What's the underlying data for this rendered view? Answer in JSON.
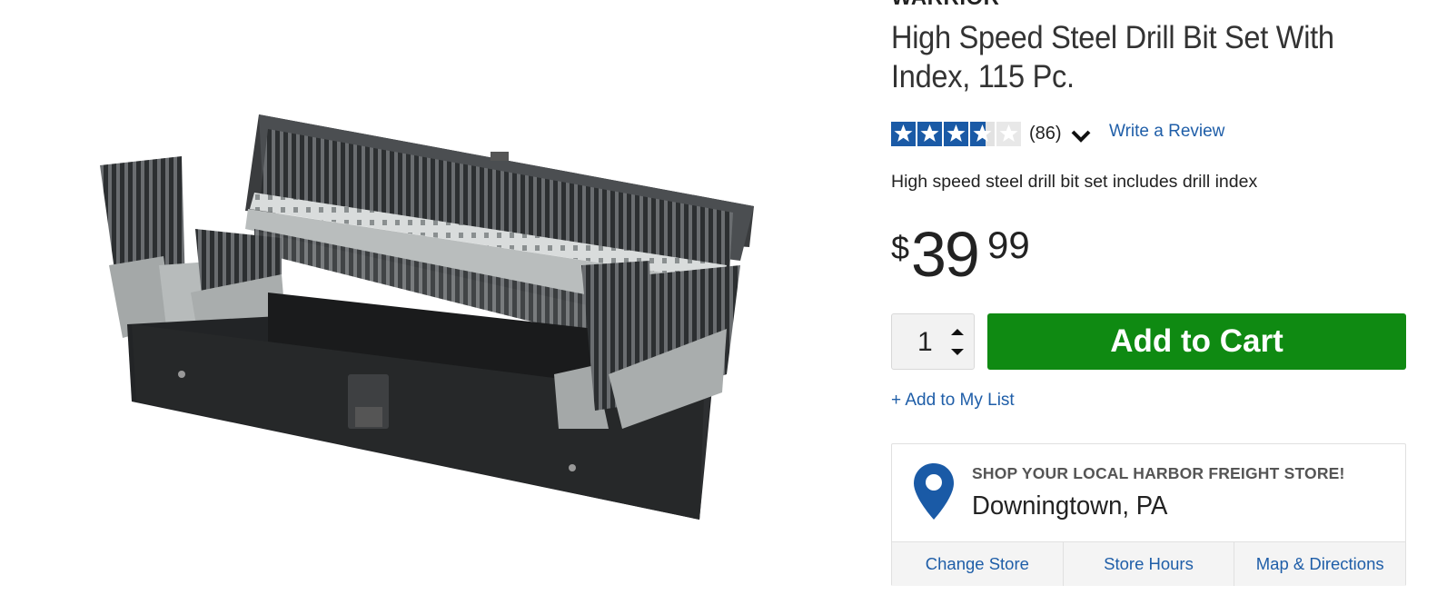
{
  "product": {
    "brand": "WARRIOR",
    "title": "High Speed Steel Drill Bit Set With Index, 115 Pc.",
    "rating": {
      "stars": 3.5,
      "max": 5,
      "count_label": "(86)",
      "write_review": "Write a Review"
    },
    "description": "High speed steel drill bit set includes drill index",
    "price": {
      "currency": "$",
      "dollars": "39",
      "cents": "99"
    },
    "quantity": "1",
    "add_to_cart": "Add to Cart",
    "add_to_list": "+ Add to My List"
  },
  "store": {
    "heading": "SHOP YOUR LOCAL HARBOR FREIGHT STORE!",
    "name": "Downingtown, PA",
    "actions": [
      "Change Store",
      "Store Hours",
      "Map & Directions"
    ]
  },
  "colors": {
    "accent_blue": "#1f5ea8",
    "cart_green": "#0f8a12",
    "star_blue": "#1a5aa6"
  },
  "icons": [
    "star-icon",
    "chevron-down-icon",
    "caret-up-icon",
    "caret-down-icon",
    "map-pin-icon"
  ]
}
